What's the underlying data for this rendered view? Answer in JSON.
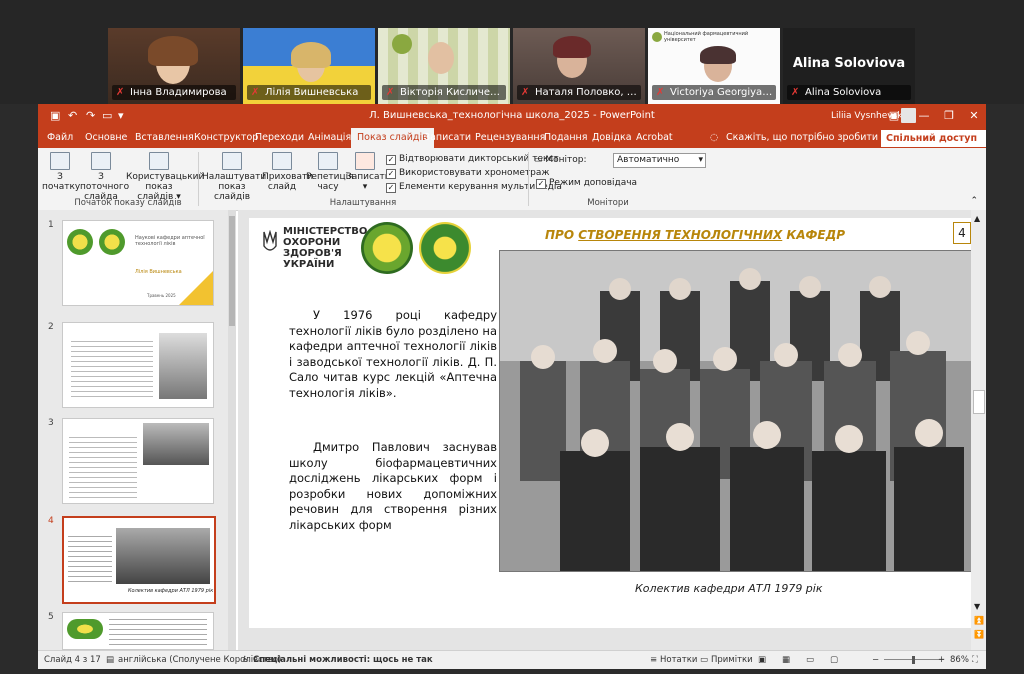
{
  "zoom": {
    "participants": [
      {
        "name": "Інна Владимирова"
      },
      {
        "name": "Лілія Вишневська"
      },
      {
        "name": "Вікторія Кисличенко, ..."
      },
      {
        "name": "Наталя Половко, про..."
      },
      {
        "name": "Victoriya Georgiyants"
      },
      {
        "name": "Alina Soloviova",
        "big_name": "Alina Soloviova"
      }
    ],
    "tile5_caption": "Національний фармацевтичний університет"
  },
  "ppt": {
    "title": "Л. Вишневська_технологічна школа_2025  -  PowerPoint",
    "user": "Liliia Vysnhevska",
    "menu": [
      "Файл",
      "Основне",
      "Вставлення",
      "Конструктор",
      "Переходи",
      "Анімація",
      "Показ слайдів",
      "Записати",
      "Рецензування",
      "Подання",
      "Довідка",
      "Acrobat"
    ],
    "tell_me": "Скажіть, що потрібно зробити",
    "share": "Спільний доступ",
    "ribbon": {
      "from_start": "З початку",
      "from_current": "З поточного слайда",
      "custom_show": "Користувацький показ слайдів",
      "group_start": "Початок показу слайдів",
      "setup_show": "Налаштувати показ слайдів",
      "hide_slide": "Приховати слайд",
      "rehearse": "Репетиція часу",
      "record": "Записати",
      "chk_narration": "Відтворювати дикторський текст",
      "chk_timings": "Використовувати хронометраж",
      "chk_controls": "Елементи керування мультимедіа",
      "group_setup": "Налаштування",
      "monitor_label": "Монітор:",
      "monitor_value": "Автоматично",
      "presenter_view": "Режим доповідача",
      "group_monitors": "Монітори"
    },
    "thumb_numbers": [
      "1",
      "2",
      "3",
      "4",
      "5"
    ],
    "thumb1": {
      "title": "Наукові кафедри аптечної технології ліків",
      "sub": "Лілія Вишневська",
      "year": "Травень 2025"
    },
    "thumb4": {
      "caption": "Колектив кафедри АТЛ 1979 рік"
    },
    "slide": {
      "ministry": "МІНІСТЕРСТВО ОХОРОНИ ЗДОРОВ'Я УКРАЇНИ",
      "heading_pre": "ПРО ",
      "heading_u": "СТВОРЕННЯ ТЕХНОЛОГІЧНИХ",
      "heading_post": " КАФЕДР",
      "number": "4",
      "p1": "У 1976 році кафедру технології ліків було розділено на кафедри аптечної технології ліків і заводської технології ліків. Д. П. Сало читав курс лекцій «Аптечна технологія ліків».",
      "p2": "Дмитро Павлович заснував школу біофармацевтичних досліджень лікарських форм і розробки нових допоміжних речовин для створення різних лікарських форм",
      "caption": "Колектив кафедри АТЛ 1979 рік"
    },
    "status": {
      "slide": "Слайд 4 з 17",
      "language": "англійська (Сполучене Королівство)",
      "accessibility": "Спеціальні можливості: щось не так",
      "notes": "Нотатки",
      "comments": "Примітки",
      "zoom": "86%"
    }
  }
}
